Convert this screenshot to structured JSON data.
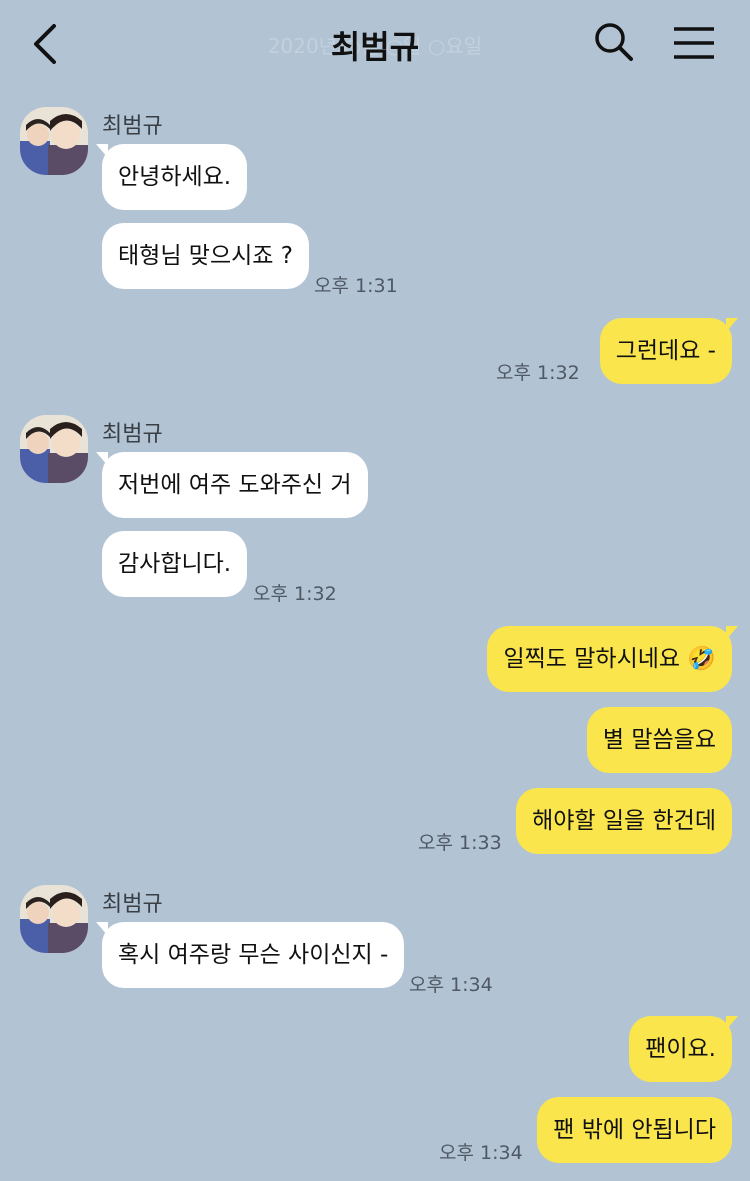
{
  "header": {
    "title": "최범규",
    "date_overlay": "2020년 ○월 ○일 ○요일",
    "back_icon": "chevron-left-icon",
    "search_icon": "search-icon",
    "menu_icon": "hamburger-menu-icon"
  },
  "colors": {
    "background": "#b2c3d4",
    "incoming_bubble": "#ffffff",
    "outgoing_bubble": "#fae64c"
  },
  "messages": {
    "g1": {
      "sender": "최범규",
      "m1": "안녕하세요.",
      "m2": "태형님 맞으시죠 ?",
      "time": "오후 1:31"
    },
    "g2": {
      "m1": "그런데요 -",
      "time": "오후 1:32"
    },
    "g3": {
      "sender": "최범규",
      "m1": "저번에 여주 도와주신 거",
      "m2": "감사합니다.",
      "time": "오후 1:32"
    },
    "g4": {
      "m1": "일찍도 말하시네요 🤣",
      "m2": "별 말씀을요",
      "m3": "해야할 일을 한건데",
      "time": "오후 1:33"
    },
    "g5": {
      "sender": "최범규",
      "m1": "혹시 여주랑 무슨 사이신지 -",
      "time": "오후 1:34"
    },
    "g6": {
      "m1": "팬이요.",
      "m2": "팬 밖에 안됩니다",
      "time": "오후 1:34"
    }
  }
}
